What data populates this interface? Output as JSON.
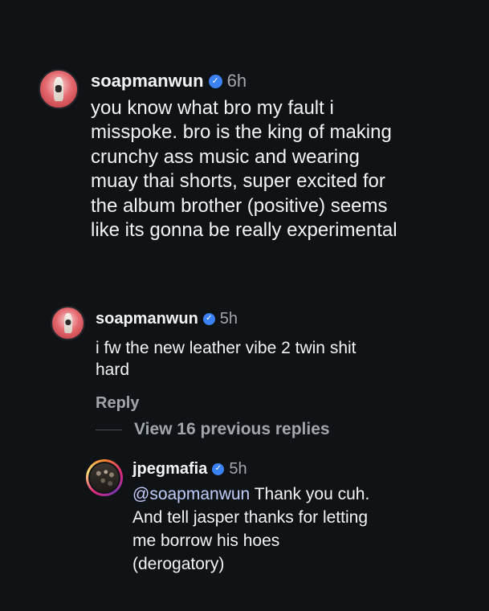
{
  "comments": [
    {
      "username": "soapmanwun",
      "verified_icon": "verified-badge-icon",
      "time": "6h",
      "text": "you know what bro my fault i\nmisspoke. bro is the king of making\ncrunchy ass music and wearing\nmuay thai shorts, super excited for\nthe album brother (positive) seems\nlike its gonna be really experimental"
    },
    {
      "username": "soapmanwun",
      "verified_icon": "verified-badge-icon",
      "time": "5h",
      "text": "i fw the new leather vibe 2 twin shit\nhard",
      "reply_label": "Reply"
    },
    {
      "username": "jpegmafia",
      "verified_icon": "verified-badge-icon",
      "time": "5h",
      "mention": "@soapmanwun",
      "text_first": " Thank you cuh.",
      "text_rest": "And tell jasper thanks for letting\nme borrow his hoes\n(derogatory)"
    }
  ],
  "view_replies_label": "View 16 previous replies",
  "colors": {
    "background": "#101316",
    "text": "#f2f3f5",
    "muted": "#a2a6ac",
    "mention": "#c0cdfb",
    "verified": "#3b82f6"
  }
}
